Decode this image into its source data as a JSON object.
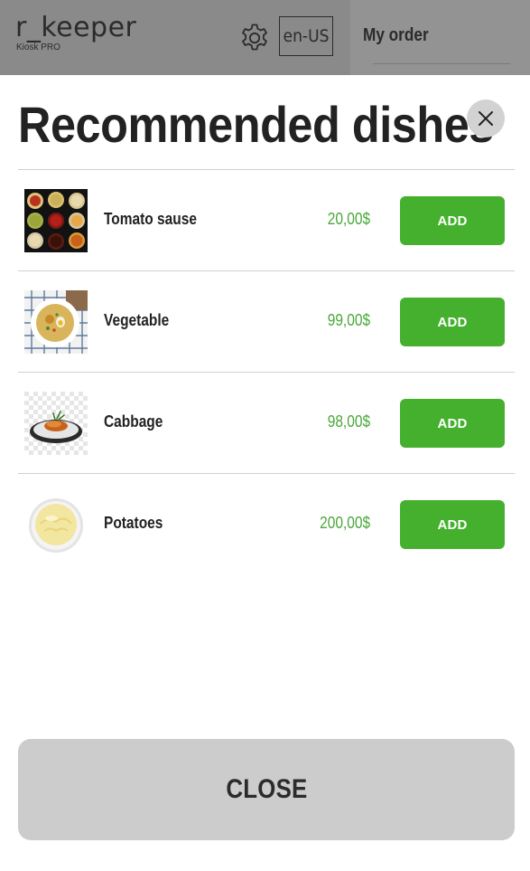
{
  "header": {
    "brand": "r_keeper",
    "brand_sub": "Kiosk PRO",
    "language": "en-US",
    "settings_icon": "gear-icon",
    "order_title": "My order"
  },
  "modal": {
    "title": "Recommended dishes",
    "close_icon": "close-icon",
    "close_label": "CLOSE",
    "dishes": [
      {
        "name": "Tomato sause",
        "price": "20,00$",
        "add_label": "ADD",
        "image": "sauces-image"
      },
      {
        "name": "Vegetable",
        "price": "99,00$",
        "add_label": "ADD",
        "image": "soup-image"
      },
      {
        "name": "Cabbage",
        "price": "98,00$",
        "add_label": "ADD",
        "image": "pasta-plate-image"
      },
      {
        "name": "Potatoes",
        "price": "200,00$",
        "add_label": "ADD",
        "image": "mashed-potatoes-image"
      }
    ]
  },
  "colors": {
    "accent_green": "#45b02e",
    "price_green": "#4aa83a",
    "overlay_gray": "#8a8a8a",
    "close_button": "#cccccc"
  }
}
